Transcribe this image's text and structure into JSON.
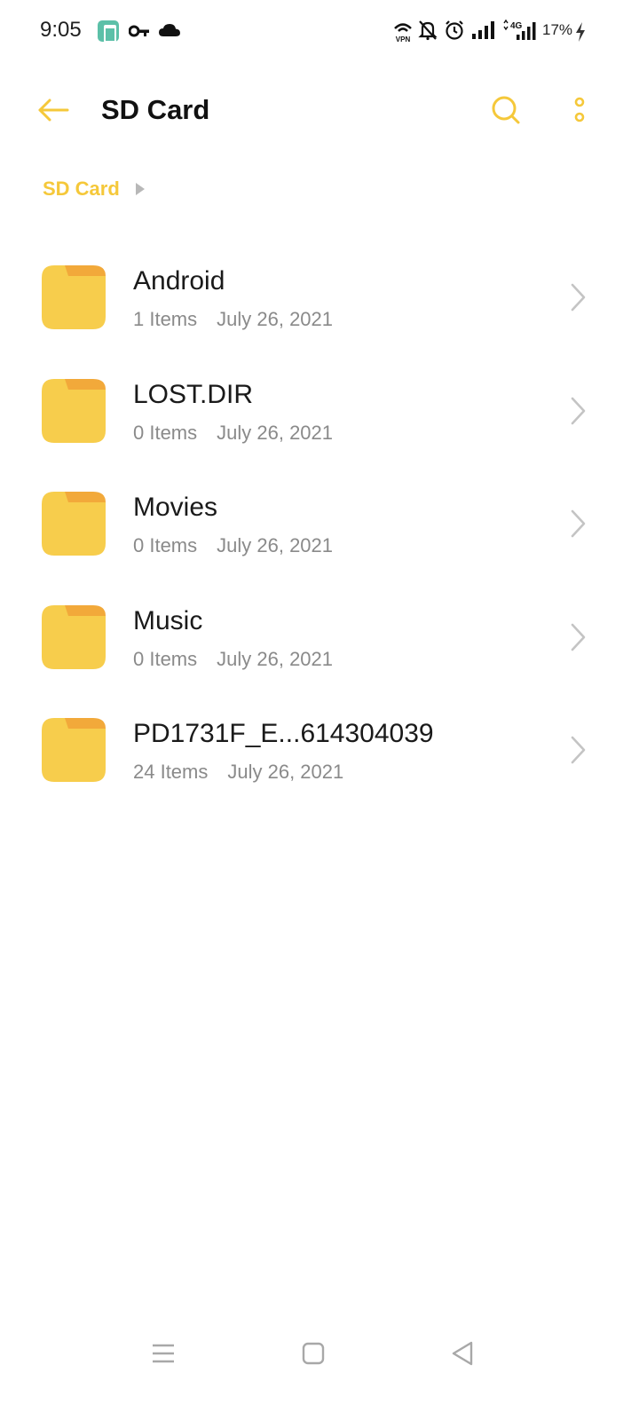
{
  "status_bar": {
    "time": "9:05",
    "battery_percent": "17%",
    "icons": [
      "app-notification-icon",
      "vpn-key-icon",
      "cloud-icon",
      "vpn-icon",
      "mute-bell-icon",
      "alarm-icon",
      "signal-icon",
      "4g-signal-icon",
      "charging-icon"
    ],
    "vpn_label": "VPN",
    "network_label": "4G"
  },
  "app_bar": {
    "title": "SD Card",
    "back_icon": "back-arrow-icon",
    "search_icon": "search-icon",
    "more_icon": "more-vertical-icon"
  },
  "breadcrumb": {
    "items": [
      "SD Card"
    ]
  },
  "files": [
    {
      "name": "Android",
      "items": "1 Items",
      "date": "July 26, 2021"
    },
    {
      "name": "LOST.DIR",
      "items": "0 Items",
      "date": "July 26, 2021"
    },
    {
      "name": "Movies",
      "items": "0 Items",
      "date": "July 26, 2021"
    },
    {
      "name": "Music",
      "items": "0 Items",
      "date": "July 26, 2021"
    },
    {
      "name": "PD1731F_E...614304039",
      "items": "24 Items",
      "date": "July 26, 2021"
    }
  ],
  "nav_bar": {
    "icons": [
      "menu-icon",
      "home-icon",
      "back-icon"
    ]
  },
  "colors": {
    "accent": "#f5c83a",
    "folder_body": "#f7cd4c",
    "folder_tab": "#f2a93a",
    "chevron": "#c4c4c4",
    "meta_text": "#8a8a8a"
  }
}
